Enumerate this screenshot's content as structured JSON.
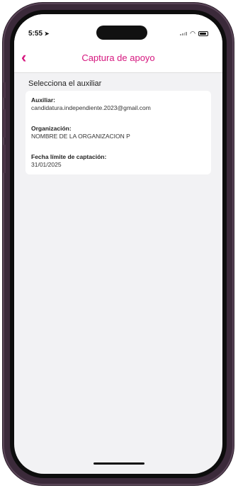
{
  "status_bar": {
    "time": "5:55",
    "icons": [
      "location-arrow-icon",
      "signal-icon",
      "wifi-icon",
      "battery-icon"
    ]
  },
  "navbar": {
    "title": "Captura de apoyo",
    "back_icon": "chevron-left-icon"
  },
  "main": {
    "section_title": "Selecciona el auxiliar",
    "auxiliar_card": {
      "fields": [
        {
          "label": "Auxiliar:",
          "value": "candidatura.independiente.2023@gmail.com"
        },
        {
          "label": "Organización:",
          "value": "NOMBRE DE LA ORGANIZACION P"
        },
        {
          "label": "Fecha límite de captación:",
          "value": "31/01/2025"
        }
      ]
    }
  },
  "colors": {
    "accent": "#d6177f",
    "background": "#f2f2f4",
    "card": "#ffffff",
    "device_frame": "#3b2a3a"
  }
}
